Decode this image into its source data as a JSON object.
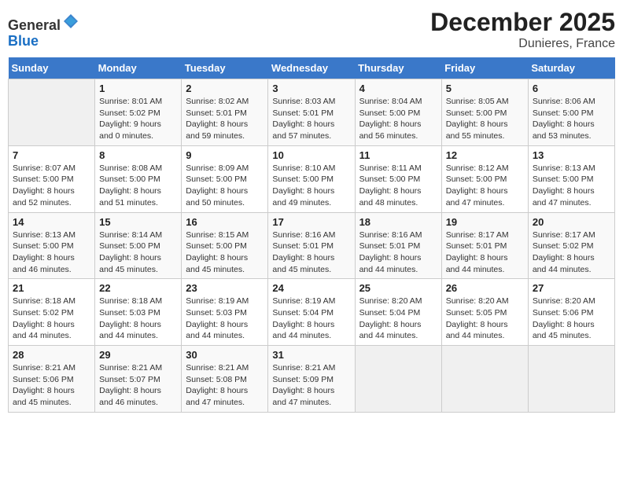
{
  "header": {
    "logo_general": "General",
    "logo_blue": "Blue",
    "title": "December 2025",
    "subtitle": "Dunieres, France"
  },
  "calendar": {
    "days_of_week": [
      "Sunday",
      "Monday",
      "Tuesday",
      "Wednesday",
      "Thursday",
      "Friday",
      "Saturday"
    ],
    "weeks": [
      [
        {
          "num": "",
          "detail": ""
        },
        {
          "num": "1",
          "detail": "Sunrise: 8:01 AM\nSunset: 5:02 PM\nDaylight: 9 hours\nand 0 minutes."
        },
        {
          "num": "2",
          "detail": "Sunrise: 8:02 AM\nSunset: 5:01 PM\nDaylight: 8 hours\nand 59 minutes."
        },
        {
          "num": "3",
          "detail": "Sunrise: 8:03 AM\nSunset: 5:01 PM\nDaylight: 8 hours\nand 57 minutes."
        },
        {
          "num": "4",
          "detail": "Sunrise: 8:04 AM\nSunset: 5:00 PM\nDaylight: 8 hours\nand 56 minutes."
        },
        {
          "num": "5",
          "detail": "Sunrise: 8:05 AM\nSunset: 5:00 PM\nDaylight: 8 hours\nand 55 minutes."
        },
        {
          "num": "6",
          "detail": "Sunrise: 8:06 AM\nSunset: 5:00 PM\nDaylight: 8 hours\nand 53 minutes."
        }
      ],
      [
        {
          "num": "7",
          "detail": "Sunrise: 8:07 AM\nSunset: 5:00 PM\nDaylight: 8 hours\nand 52 minutes."
        },
        {
          "num": "8",
          "detail": "Sunrise: 8:08 AM\nSunset: 5:00 PM\nDaylight: 8 hours\nand 51 minutes."
        },
        {
          "num": "9",
          "detail": "Sunrise: 8:09 AM\nSunset: 5:00 PM\nDaylight: 8 hours\nand 50 minutes."
        },
        {
          "num": "10",
          "detail": "Sunrise: 8:10 AM\nSunset: 5:00 PM\nDaylight: 8 hours\nand 49 minutes."
        },
        {
          "num": "11",
          "detail": "Sunrise: 8:11 AM\nSunset: 5:00 PM\nDaylight: 8 hours\nand 48 minutes."
        },
        {
          "num": "12",
          "detail": "Sunrise: 8:12 AM\nSunset: 5:00 PM\nDaylight: 8 hours\nand 47 minutes."
        },
        {
          "num": "13",
          "detail": "Sunrise: 8:13 AM\nSunset: 5:00 PM\nDaylight: 8 hours\nand 47 minutes."
        }
      ],
      [
        {
          "num": "14",
          "detail": "Sunrise: 8:13 AM\nSunset: 5:00 PM\nDaylight: 8 hours\nand 46 minutes."
        },
        {
          "num": "15",
          "detail": "Sunrise: 8:14 AM\nSunset: 5:00 PM\nDaylight: 8 hours\nand 45 minutes."
        },
        {
          "num": "16",
          "detail": "Sunrise: 8:15 AM\nSunset: 5:00 PM\nDaylight: 8 hours\nand 45 minutes."
        },
        {
          "num": "17",
          "detail": "Sunrise: 8:16 AM\nSunset: 5:01 PM\nDaylight: 8 hours\nand 45 minutes."
        },
        {
          "num": "18",
          "detail": "Sunrise: 8:16 AM\nSunset: 5:01 PM\nDaylight: 8 hours\nand 44 minutes."
        },
        {
          "num": "19",
          "detail": "Sunrise: 8:17 AM\nSunset: 5:01 PM\nDaylight: 8 hours\nand 44 minutes."
        },
        {
          "num": "20",
          "detail": "Sunrise: 8:17 AM\nSunset: 5:02 PM\nDaylight: 8 hours\nand 44 minutes."
        }
      ],
      [
        {
          "num": "21",
          "detail": "Sunrise: 8:18 AM\nSunset: 5:02 PM\nDaylight: 8 hours\nand 44 minutes."
        },
        {
          "num": "22",
          "detail": "Sunrise: 8:18 AM\nSunset: 5:03 PM\nDaylight: 8 hours\nand 44 minutes."
        },
        {
          "num": "23",
          "detail": "Sunrise: 8:19 AM\nSunset: 5:03 PM\nDaylight: 8 hours\nand 44 minutes."
        },
        {
          "num": "24",
          "detail": "Sunrise: 8:19 AM\nSunset: 5:04 PM\nDaylight: 8 hours\nand 44 minutes."
        },
        {
          "num": "25",
          "detail": "Sunrise: 8:20 AM\nSunset: 5:04 PM\nDaylight: 8 hours\nand 44 minutes."
        },
        {
          "num": "26",
          "detail": "Sunrise: 8:20 AM\nSunset: 5:05 PM\nDaylight: 8 hours\nand 44 minutes."
        },
        {
          "num": "27",
          "detail": "Sunrise: 8:20 AM\nSunset: 5:06 PM\nDaylight: 8 hours\nand 45 minutes."
        }
      ],
      [
        {
          "num": "28",
          "detail": "Sunrise: 8:21 AM\nSunset: 5:06 PM\nDaylight: 8 hours\nand 45 minutes."
        },
        {
          "num": "29",
          "detail": "Sunrise: 8:21 AM\nSunset: 5:07 PM\nDaylight: 8 hours\nand 46 minutes."
        },
        {
          "num": "30",
          "detail": "Sunrise: 8:21 AM\nSunset: 5:08 PM\nDaylight: 8 hours\nand 47 minutes."
        },
        {
          "num": "31",
          "detail": "Sunrise: 8:21 AM\nSunset: 5:09 PM\nDaylight: 8 hours\nand 47 minutes."
        },
        {
          "num": "",
          "detail": ""
        },
        {
          "num": "",
          "detail": ""
        },
        {
          "num": "",
          "detail": ""
        }
      ]
    ]
  }
}
